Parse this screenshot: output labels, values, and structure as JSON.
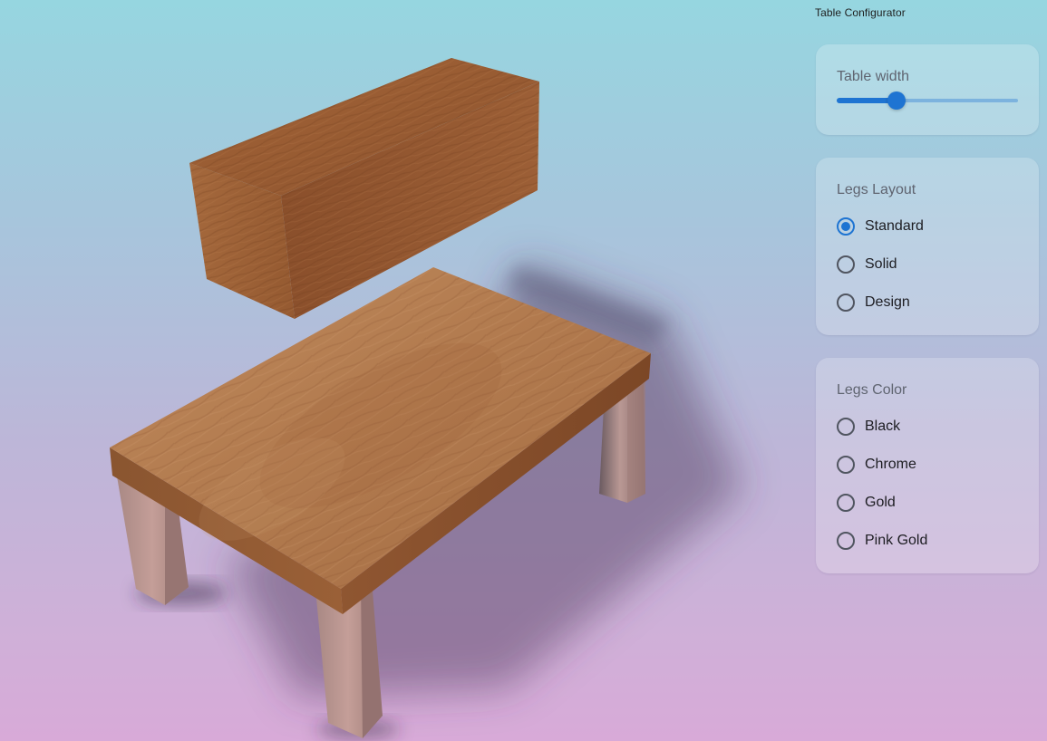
{
  "app_title": "Table Configurator",
  "width_control": {
    "label": "Table width",
    "value_fraction": 0.33
  },
  "legs_layout": {
    "label": "Legs Layout",
    "options": [
      {
        "label": "Standard",
        "checked": true
      },
      {
        "label": "Solid",
        "checked": false
      },
      {
        "label": "Design",
        "checked": false
      }
    ]
  },
  "legs_color": {
    "label": "Legs Color",
    "options": [
      {
        "label": "Black",
        "checked": false
      },
      {
        "label": "Chrome",
        "checked": false
      },
      {
        "label": "Gold",
        "checked": false
      },
      {
        "label": "Pink Gold",
        "checked": false
      }
    ]
  },
  "colors": {
    "accent": "#1e74d2",
    "wood": "#b07a4e",
    "leg": "#b08a86"
  }
}
